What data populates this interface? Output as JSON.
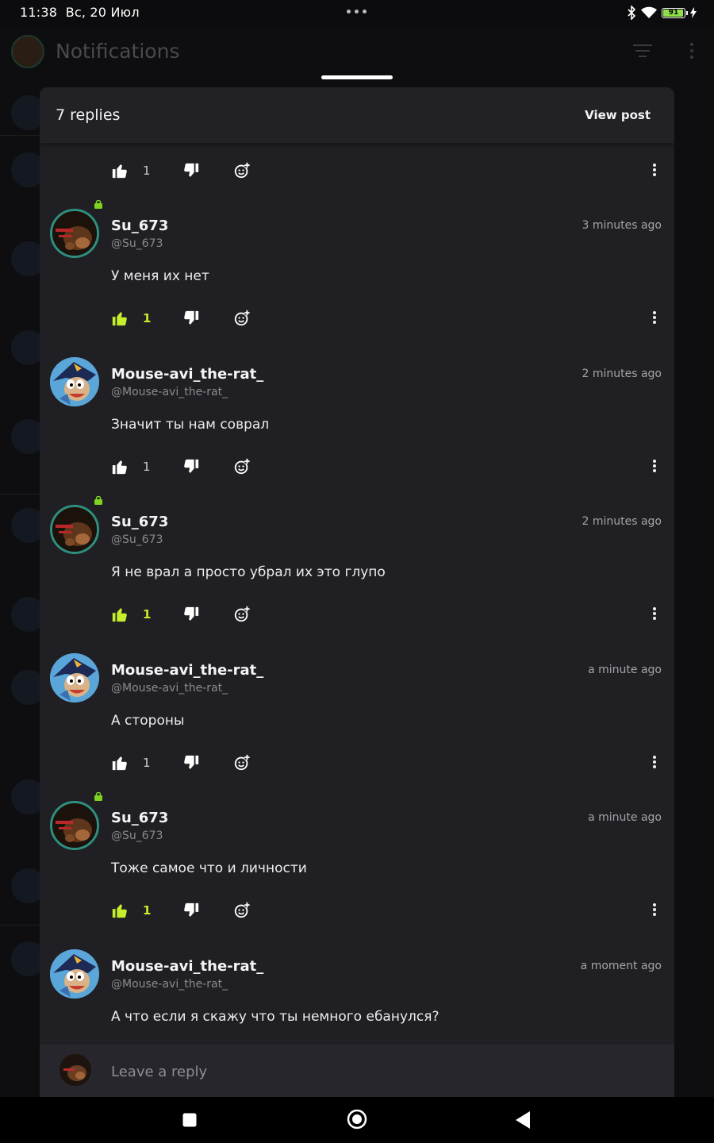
{
  "status_bar": {
    "time": "11:38",
    "date": "Вс, 20 Июл",
    "battery": "91"
  },
  "background": {
    "title": "Notifications"
  },
  "sheet": {
    "reply_count": "7 replies",
    "view_post": "View post"
  },
  "top_action": {
    "likes": "1",
    "liked": false
  },
  "comments": [
    {
      "name": "Su_673",
      "handle": "@Su_673",
      "time": "3 minutes ago",
      "text": "У меня их нет",
      "likes": "1",
      "liked": true,
      "avatar": "su"
    },
    {
      "name": "Mouse-avi_the-rat_",
      "handle": "@Mouse-avi_the-rat_",
      "time": "2 minutes ago",
      "text": "Значит ты нам соврал",
      "likes": "1",
      "liked": false,
      "avatar": "mouse"
    },
    {
      "name": "Su_673",
      "handle": "@Su_673",
      "time": "2 minutes ago",
      "text": "Я не врал а просто убрал их это глупо",
      "likes": "1",
      "liked": true,
      "avatar": "su"
    },
    {
      "name": "Mouse-avi_the-rat_",
      "handle": "@Mouse-avi_the-rat_",
      "time": "a minute ago",
      "text": "А стороны",
      "likes": "1",
      "liked": false,
      "avatar": "mouse"
    },
    {
      "name": "Su_673",
      "handle": "@Su_673",
      "time": "a minute ago",
      "text": "Тоже самое что и личности",
      "likes": "1",
      "liked": true,
      "avatar": "su"
    },
    {
      "name": "Mouse-avi_the-rat_",
      "handle": "@Mouse-avi_the-rat_",
      "time": "a moment ago",
      "text": "А что если я скажу что ты немного ебанулся?",
      "likes": "",
      "liked": false,
      "avatar": "mouse"
    }
  ],
  "reply_bar": {
    "placeholder": "Leave a reply"
  },
  "colors": {
    "like_active": "#c6ee2c",
    "sheet_bg": "#202024",
    "su_ring": "#2e8f80"
  },
  "icons": [
    "thumbs-up-icon",
    "thumbs-down-icon",
    "add-reaction-icon",
    "more-vert-icon",
    "filter-icon",
    "bluetooth-icon",
    "wifi-icon",
    "battery-icon",
    "charging-icon",
    "nav-square-icon",
    "nav-home-icon",
    "nav-back-icon",
    "lock-icon"
  ]
}
